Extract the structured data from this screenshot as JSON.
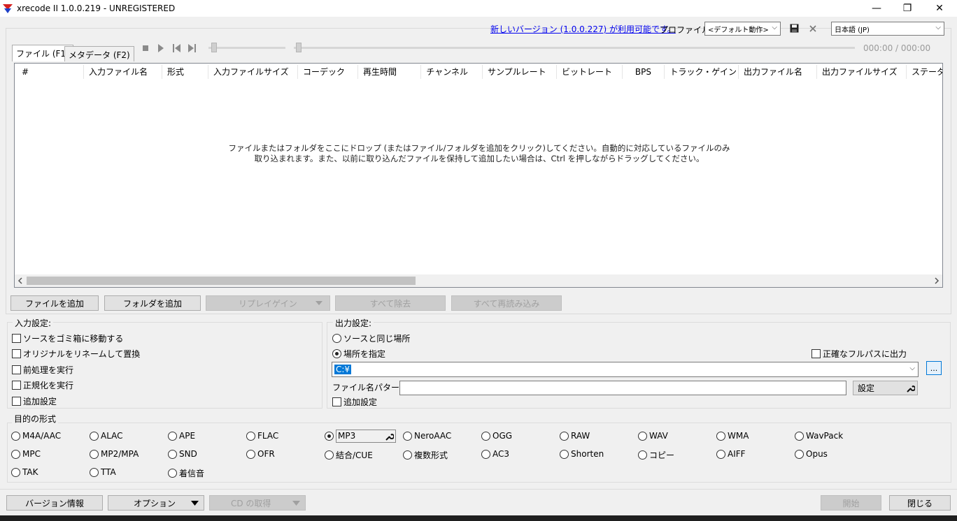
{
  "window": {
    "title": "xrecode II 1.0.0.219 - UNREGISTERED",
    "minimize_glyph": "—",
    "maximize_glyph": "❐",
    "close_glyph": "✕"
  },
  "topbar": {
    "update_link": "新しいバージョン (1.0.0.227) が利用可能です。",
    "profile_label": "プロファイル:",
    "profile_value": "<デフォルト動作>",
    "language_value": "日本語 (JP)"
  },
  "player": {
    "time": "000:00 / 000:00"
  },
  "tabs": [
    {
      "label": "ファイル (F1)"
    },
    {
      "label": "メタデータ (F2)"
    }
  ],
  "table": {
    "columns": [
      "#",
      "入力ファイル名",
      "形式",
      "入力ファイルサイズ",
      "コーデック",
      "再生時間",
      "チャンネル",
      "サンプルレート",
      "ビットレート",
      "BPS",
      "トラック・ゲイン",
      "出力ファイル名",
      "出力ファイルサイズ",
      "ステータス"
    ],
    "empty_line1": "ファイルまたはフォルダをここにドロップ (またはファイル/フォルダを追加をクリック)してください。自動的に対応しているファイルのみ",
    "empty_line2": "取り込まれます。また、以前に取り込んだファイルを保持して追加したい場合は、Ctrl を押しながらドラッグしてください。"
  },
  "actions": {
    "add_file": "ファイルを追加",
    "add_folder": "フォルダを追加",
    "replaygain": "リプレイゲイン",
    "remove_all": "すべて除去",
    "reload_all": "すべて再読み込み"
  },
  "input_settings": {
    "title": "入力設定:",
    "options": [
      "ソースをゴミ箱に移動する",
      "オリジナルをリネームして置換",
      "前処理を実行",
      "正規化を実行",
      "追加設定"
    ]
  },
  "output_settings": {
    "title": "出力設定:",
    "same_as_source": "ソースと同じ場所",
    "specify_location": "場所を指定",
    "exact_fullpath": "正確なフルパスに出力",
    "path_value": "C:¥",
    "browse_label": "...",
    "filename_pattern_label": "ファイル名パターン:",
    "filename_pattern_value": "",
    "settings_button": "設定",
    "extra": "追加設定"
  },
  "formats": {
    "title": "目的の形式",
    "selected": "MP3",
    "row1": [
      "M4A/AAC",
      "ALAC",
      "APE",
      "FLAC",
      "MP3",
      "NeroAAC",
      "OGG",
      "RAW",
      "WAV",
      "WMA",
      "WavPack"
    ],
    "row2": [
      "MPC",
      "MP2/MPA",
      "SND",
      "OFR",
      "結合/CUE",
      "複数形式",
      "AC3",
      "Shorten",
      "コピー",
      "AIFF",
      "Opus"
    ],
    "row3": [
      "TAK",
      "TTA",
      "着信音"
    ]
  },
  "bottom": {
    "version_info": "バージョン情報",
    "options": "オプション",
    "cd_rip": "CD の取得",
    "start": "開始",
    "close": "閉じる"
  }
}
